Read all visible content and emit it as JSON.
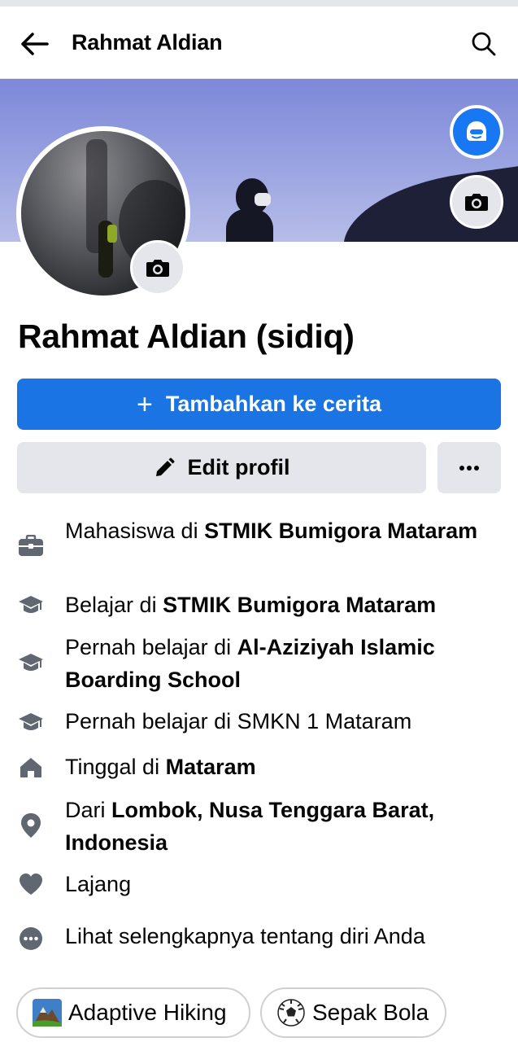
{
  "header": {
    "title": "Rahmat Aldian",
    "back_icon": "arrow-left-icon",
    "search_icon": "search-icon"
  },
  "profile": {
    "name": "Rahmat Aldian (sidiq)"
  },
  "actions": {
    "add_story_label": "Tambahkan ke cerita",
    "add_story_plus": "+",
    "edit_profile_label": "Edit profil",
    "more_label": "···"
  },
  "details": [
    {
      "icon": "briefcase-icon",
      "prefix": "Mahasiswa di ",
      "bold": "STMIK Bumigora Mataram"
    },
    {
      "icon": "graduation-cap-icon",
      "prefix": "Belajar di ",
      "bold": "STMIK Bumigora Mataram"
    },
    {
      "icon": "graduation-cap-icon",
      "prefix": "Pernah belajar di ",
      "bold": "Al-Aziziyah Islamic Boarding School"
    },
    {
      "icon": "graduation-cap-icon",
      "prefix": "Pernah belajar di SMKN 1 Mataram",
      "bold": ""
    },
    {
      "icon": "home-icon",
      "prefix": "Tinggal di ",
      "bold": "Mataram"
    },
    {
      "icon": "location-pin-icon",
      "prefix": "Dari ",
      "bold": "Lombok, Nusa Tenggara Barat, Indonesia"
    },
    {
      "icon": "heart-icon",
      "prefix": "Lajang",
      "bold": ""
    },
    {
      "icon": "ellipsis-circle-icon",
      "prefix": "Lihat selengkapnya tentang diri Anda",
      "bold": ""
    }
  ],
  "hobbies": [
    {
      "icon": "mountain-emoji-icon",
      "label": "Adaptive Hiking"
    },
    {
      "icon": "soccer-ball-emoji-icon",
      "label": "Sepak Bola"
    }
  ],
  "colors": {
    "primary": "#1b74e4",
    "secondary_bg": "#e4e6eb",
    "icon_gray": "#606770",
    "text": "#050505"
  }
}
